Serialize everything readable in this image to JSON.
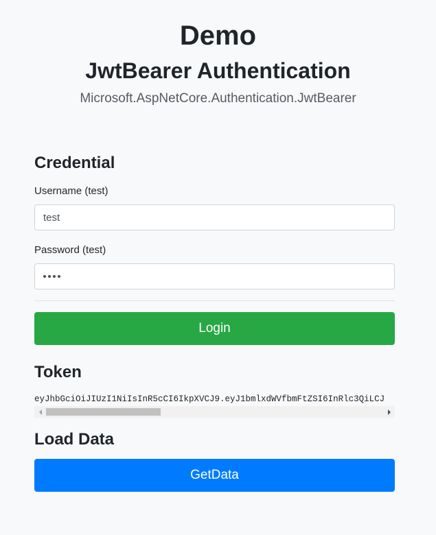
{
  "header": {
    "title": "Demo",
    "subtitle": "JwtBearer Authentication",
    "package": "Microsoft.AspNetCore.Authentication.JwtBearer"
  },
  "credential": {
    "heading": "Credential",
    "username_label": "Username (test)",
    "username_value": "test",
    "password_label": "Password (test)",
    "password_mask": "••••",
    "login_label": "Login"
  },
  "token": {
    "heading": "Token",
    "value": "eyJhbGciOiJIUzI1NiIsInR5cCI6IkpXVCJ9.eyJ1bmlxdWVfbmFtZSI6InRlc3QiLCJ"
  },
  "load_data": {
    "heading": "Load Data",
    "getdata_label": "GetData"
  },
  "colors": {
    "login_button": "#28a745",
    "getdata_button": "#007bff",
    "background": "#f8f9fa"
  }
}
